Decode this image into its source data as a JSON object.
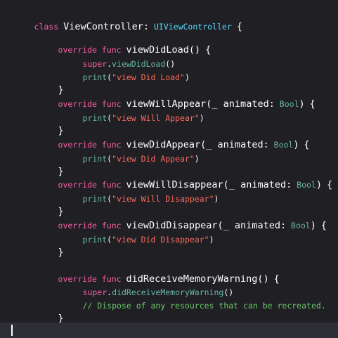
{
  "colors": {
    "background": "#1f1f24",
    "keyword": "#fc5fa3",
    "type": "#5dd8ff",
    "call": "#67b7a4",
    "string": "#fc6a5d",
    "comment": "#6cc96a",
    "plain": "#ffffff",
    "current_line": "#2e2f36"
  },
  "code": {
    "class_kw": "class",
    "class_name": "ViewController",
    "colon": ":",
    "superclass": "UIViewController",
    "open_brace": "{",
    "close_brace": "}",
    "override_kw": "override",
    "func_kw": "func",
    "super_kw": "super",
    "print_fn": "print",
    "paren_open": "(",
    "paren_close": ")",
    "param_prefix": "_ animated:",
    "bool_type": "Bool",
    "method_view_did_load": "viewDidLoad()",
    "call_view_did_load": "viewDidLoad",
    "str_view_did_load": "\"view Did Load\"",
    "method_view_will_appear": "viewWillAppear(",
    "str_view_will_appear": "\"view Will Appear\"",
    "method_view_did_appear": "viewDidAppear(",
    "str_view_did_appear": "\"view Did Appear\"",
    "method_view_will_disappear": "viewWillDisappear(",
    "str_view_will_disappear": "\"view Will Disappear\"",
    "method_view_did_disappear": "viewDidDisappear(",
    "str_view_did_disappear": "\"view Did Disappear\"",
    "method_memory_warning": "didReceiveMemoryWarning()",
    "call_memory_warning": "didReceiveMemoryWarning",
    "comment_dispose": "// Dispose of any resources that can be recreated."
  }
}
